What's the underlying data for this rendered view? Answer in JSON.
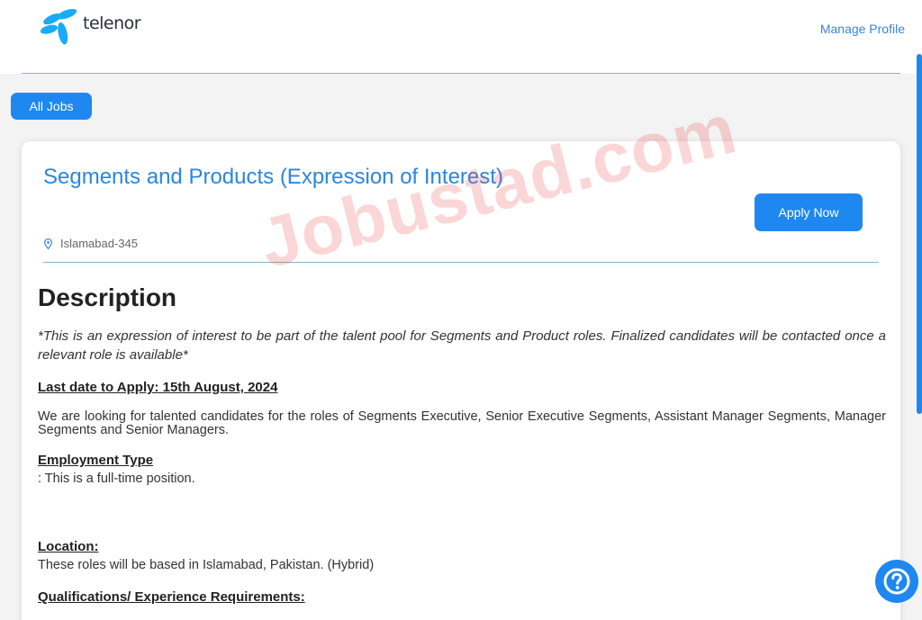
{
  "header": {
    "brand": "telenor",
    "manage_profile": "Manage Profile"
  },
  "nav": {
    "all_jobs": "All Jobs"
  },
  "job": {
    "title": "Segments and Products (Expression of Interest)",
    "apply_label": "Apply Now",
    "location": "Islamabad-345",
    "description_heading": "Description",
    "intro": "*This is an expression of interest to be part of the talent pool for Segments and Product roles. Finalized candidates will be contacted once a relevant role is available*",
    "last_date": "Last date to Apply: 15th August, 2024",
    "looking_for": "We are looking for talented candidates for the roles of Segments Executive, Senior Executive Segments, Assistant Manager Segments, Manager Segments and Senior Managers.",
    "employment_type_heading": "Employment Type",
    "employment_type_text": ": This is a full-time position.",
    "location_heading": "Location:",
    "location_text": "These roles will be based in Islamabad, Pakistan. (Hybrid)",
    "qualifications_heading": "Qualifications/ Experience Requirements:"
  },
  "watermark": "Jobustad.com",
  "colors": {
    "accent": "#1e88f0",
    "title_blue": "#2b86df",
    "rule": "#7fb6c6",
    "logo": "#19aaf8"
  },
  "icons": {
    "brand": "telenor-logo-icon",
    "location": "map-pin-icon",
    "help": "question-circle-icon"
  }
}
